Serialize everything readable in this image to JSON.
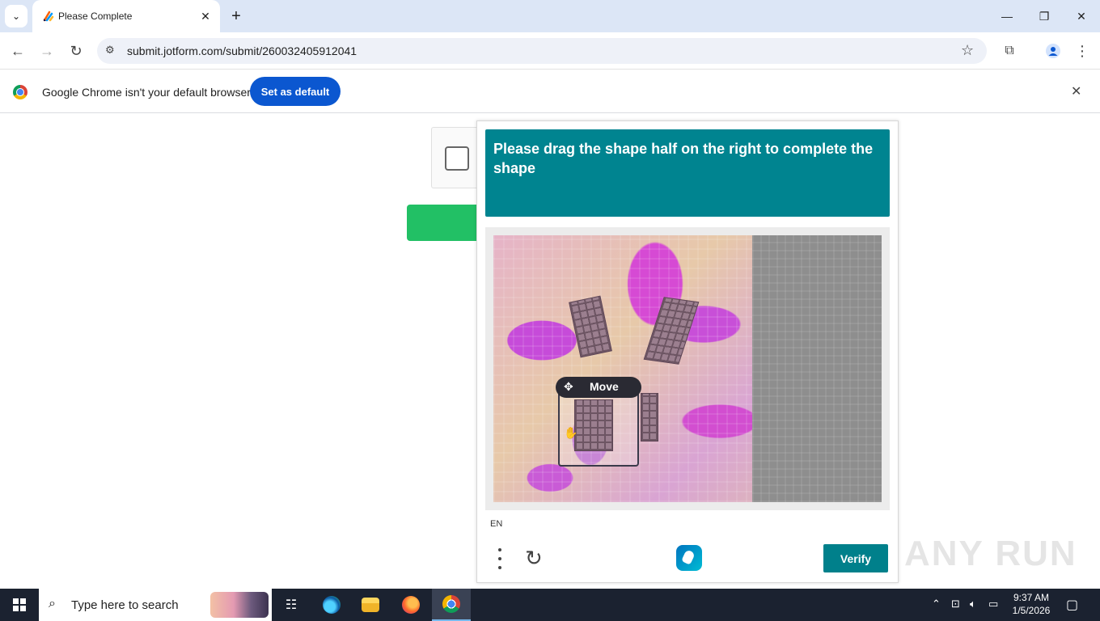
{
  "browser": {
    "tab": {
      "title": "Please Complete",
      "close": "✕"
    },
    "new_tab": "+",
    "window_controls": {
      "minimize": "—",
      "maximize": "❐",
      "close": "✕"
    },
    "nav": {
      "back": "←",
      "forward": "→",
      "reload": "↻"
    },
    "url": "submit.jotform.com/submit/260032405912041",
    "icons": [
      "tab-list-icon",
      "site-info-icon",
      "star-icon",
      "extensions-icon",
      "profile-icon",
      "kebab-menu-icon"
    ]
  },
  "infobar": {
    "message": "Google Chrome isn't your default browser",
    "button": "Set as default",
    "close": "✕"
  },
  "captcha": {
    "prompt": "Please drag the shape half on the right to complete the shape",
    "move_label": "Move",
    "language": "EN",
    "verify_label": "Verify",
    "accent_color": "#008490"
  },
  "watermark": "ANY RUN",
  "taskbar": {
    "search_placeholder": "Type here to search",
    "apps": [
      "task-view",
      "edge",
      "file-explorer",
      "firefox",
      "chrome"
    ],
    "time": "9:37 AM",
    "date": "1/5/2026"
  }
}
